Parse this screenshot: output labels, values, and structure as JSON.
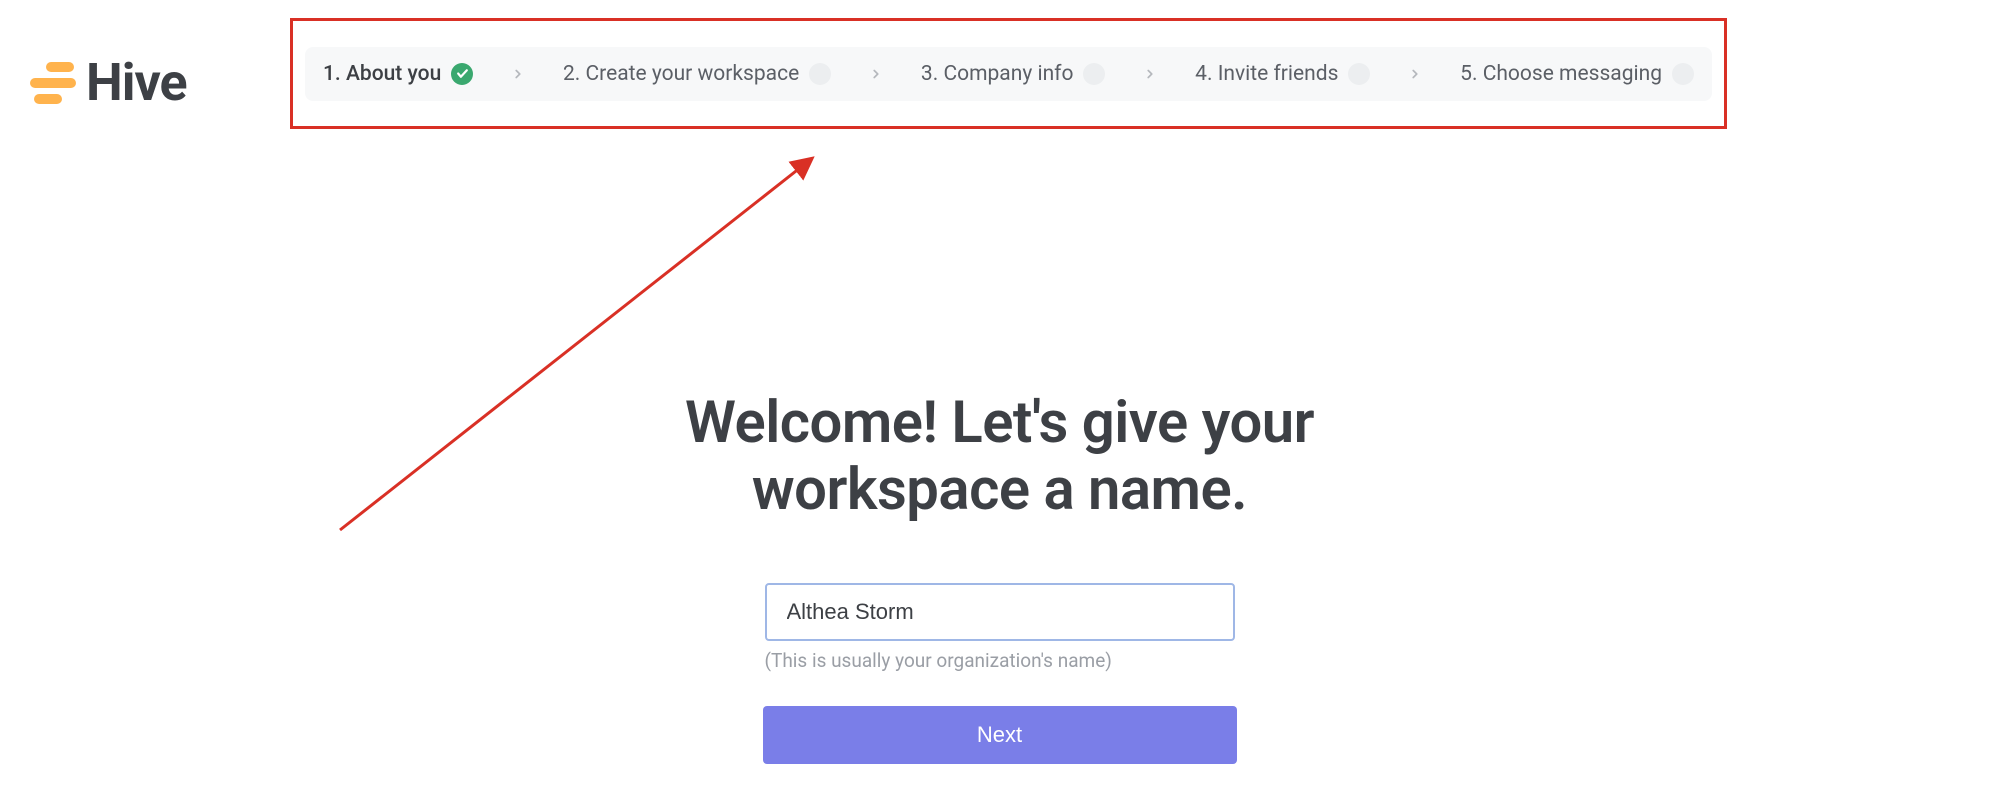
{
  "brand": {
    "name": "Hive"
  },
  "stepper": {
    "steps": [
      {
        "label": "1. About you",
        "status": "done"
      },
      {
        "label": "2. Create your workspace",
        "status": "pending"
      },
      {
        "label": "3. Company info",
        "status": "pending"
      },
      {
        "label": "4. Invite friends",
        "status": "pending"
      },
      {
        "label": "5. Choose messaging",
        "status": "pending"
      }
    ]
  },
  "main": {
    "heading": "Welcome! Let's give your workspace a name.",
    "workspace_value": "Althea Storm",
    "hint": "(This is usually your organization's name)",
    "next_label": "Next"
  },
  "annotation": {
    "highlight_color": "#d93025"
  }
}
